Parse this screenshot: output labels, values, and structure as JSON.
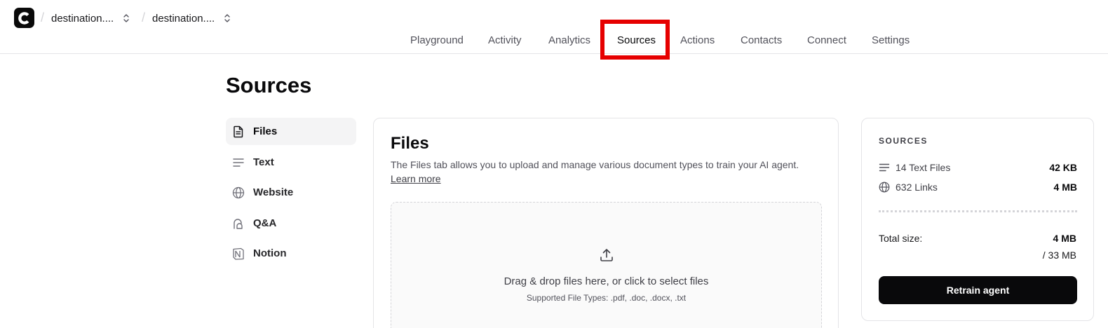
{
  "app": {
    "logo_icon": "chatbase-c-logo-icon"
  },
  "breadcrumb": {
    "separator": "/",
    "workspace": {
      "label": "destination....",
      "icon": "chevron-up-down-icon"
    },
    "agent": {
      "label": "destination....",
      "icon": "chevron-up-down-icon"
    }
  },
  "nav": {
    "tabs": [
      {
        "label": "Playground"
      },
      {
        "label": "Activity"
      },
      {
        "label": "Analytics"
      },
      {
        "label": "Sources",
        "active": true
      },
      {
        "label": "Actions"
      },
      {
        "label": "Contacts"
      },
      {
        "label": "Connect"
      },
      {
        "label": "Settings"
      }
    ],
    "highlight_color": "#e60000"
  },
  "page": {
    "title": "Sources"
  },
  "subnav": {
    "items": [
      {
        "label": "Files",
        "icon": "file-text-icon",
        "active": true
      },
      {
        "label": "Text",
        "icon": "text-lines-icon"
      },
      {
        "label": "Website",
        "icon": "globe-icon"
      },
      {
        "label": "Q&A",
        "icon": "qa-bubble-icon"
      },
      {
        "label": "Notion",
        "icon": "notion-icon"
      }
    ]
  },
  "files": {
    "title": "Files",
    "description": "The Files tab allows you to upload and manage various document types to train your AI agent.",
    "learn_more": "Learn more",
    "dropzone": {
      "icon": "upload-icon",
      "main_text": "Drag & drop files here, or click to select files",
      "supported_text": "Supported File Types: .pdf, .doc, .docx, .txt"
    }
  },
  "summary": {
    "heading": "SOURCES",
    "rows": [
      {
        "label": "14 Text Files",
        "value": "42 KB",
        "icon": "text-lines-icon"
      },
      {
        "label": "632 Links",
        "value": "4 MB",
        "icon": "globe-icon"
      }
    ],
    "total_label": "Total size:",
    "total_value": "4 MB",
    "total_limit": "/ 33 MB",
    "retrain_label": "Retrain agent"
  }
}
